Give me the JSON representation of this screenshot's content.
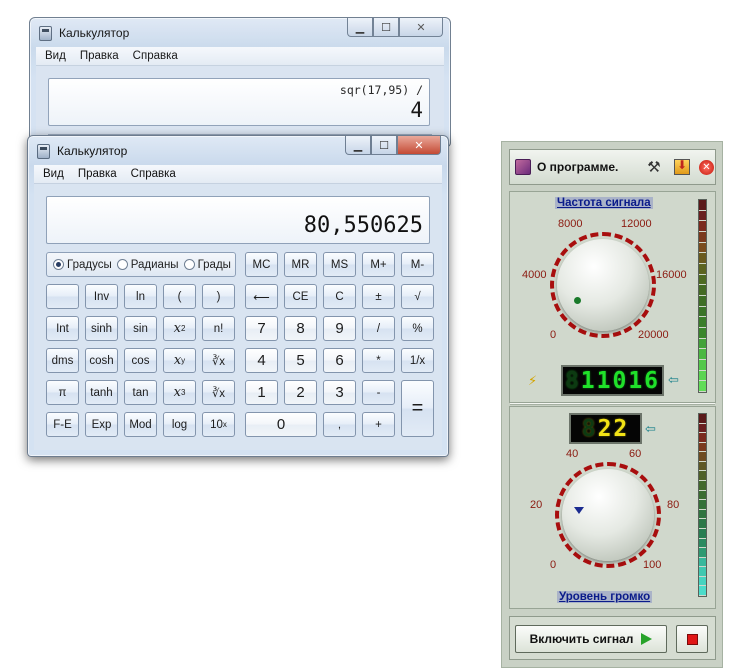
{
  "calc_back": {
    "title": "Калькулятор",
    "menu": [
      "Вид",
      "Правка",
      "Справка"
    ],
    "expression": "sqr(17,95) /",
    "value": "4"
  },
  "calc_front": {
    "title": "Калькулятор",
    "menu": [
      "Вид",
      "Правка",
      "Справка"
    ],
    "value": "80,550625",
    "angle_modes": [
      {
        "label": "Градусы",
        "selected": true
      },
      {
        "label": "Радианы",
        "selected": false
      },
      {
        "label": "Грады",
        "selected": false
      }
    ],
    "memory": [
      "MC",
      "MR",
      "MS",
      "M+",
      "M-"
    ],
    "keys": {
      "inv": "Inv",
      "ln": "ln",
      "lparen": "(",
      "rparen": ")",
      "back": "⟵",
      "ce": "CE",
      "c": "C",
      "pm": "±",
      "sqrt": "√",
      "int": "Int",
      "sinh": "sinh",
      "sin": "sin",
      "x2": "x",
      "x2_sup": "2",
      "fact": "n!",
      "k7": "7",
      "k8": "8",
      "k9": "9",
      "div": "/",
      "pct": "%",
      "dms": "dms",
      "cosh": "cosh",
      "cos": "cos",
      "xy": "x",
      "xy_sup": "y",
      "yroot": "∛x",
      "k4": "4",
      "k5": "5",
      "k6": "6",
      "mul": "*",
      "recip": "1/x",
      "pi": "π",
      "tanh": "tanh",
      "tan": "tan",
      "x3": "x",
      "x3_sup": "3",
      "cbrt": "∛x",
      "k1": "1",
      "k2": "2",
      "k3": "3",
      "sub": "-",
      "eq": "=",
      "fe": "F-E",
      "exp": "Exp",
      "mod": "Mod",
      "log": "log",
      "tenx": "10",
      "tenx_sup": "x",
      "k0": "0",
      "dot": ",",
      "add": "+"
    }
  },
  "generator": {
    "about": "О программе.",
    "frequency": {
      "title": "Частота сигнала",
      "scale": [
        "0",
        "4000",
        "8000",
        "12000",
        "16000",
        "20000"
      ],
      "display": "11016",
      "display_dim": "8"
    },
    "volume": {
      "title": "Уровень громко",
      "scale": [
        "0",
        "20",
        "40",
        "60",
        "80",
        "100"
      ],
      "display": "22",
      "display_dim": "8"
    },
    "start_label": "Включить сигнал",
    "colors": {
      "led_green": "#20e12a",
      "led_yellow": "#f2e216",
      "scale_red": "#8b1a10",
      "title_blue": "#0a1b8a"
    }
  }
}
